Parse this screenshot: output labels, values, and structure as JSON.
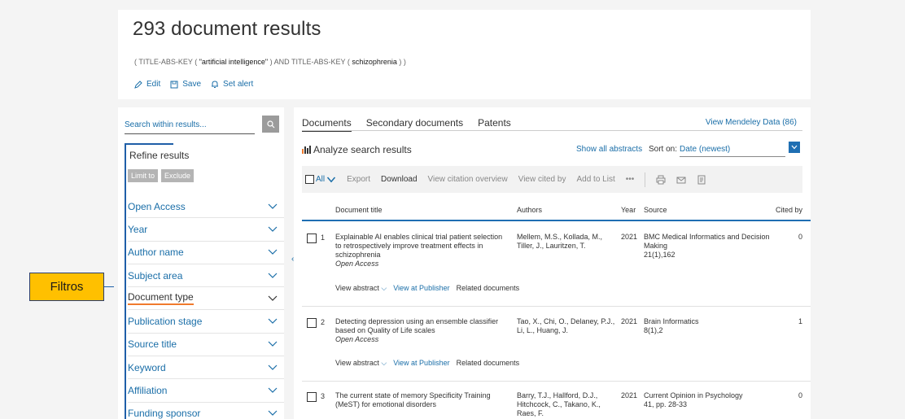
{
  "header": {
    "results_title": "293 document results",
    "query": {
      "part1": "( TITLE-ABS-KEY ( ",
      "term1": "\"artificial intelligence\"",
      "part2": " ) AND  TITLE-ABS-KEY ( ",
      "term2": "schizophrenia",
      "part3": " ) )"
    },
    "actions": {
      "edit": "Edit",
      "save": "Save",
      "alert": "Set alert"
    }
  },
  "sidebar": {
    "search_placeholder": "Search within results...",
    "refine_title": "Refine results",
    "limit_to": "Limit to",
    "exclude": "Exclude",
    "filters": [
      {
        "label": "Open Access"
      },
      {
        "label": "Year"
      },
      {
        "label": "Author name"
      },
      {
        "label": "Subject area"
      },
      {
        "label": "Document type"
      },
      {
        "label": "Publication stage"
      },
      {
        "label": "Source title"
      },
      {
        "label": "Keyword"
      },
      {
        "label": "Affiliation"
      },
      {
        "label": "Funding sponsor"
      }
    ]
  },
  "annotation": {
    "label": "Filtros",
    "color": "#ffc000"
  },
  "main": {
    "tabs": [
      "Documents",
      "Secondary documents",
      "Patents"
    ],
    "mendeley": "View Mendeley Data (86)",
    "analyze": "Analyze search results",
    "show_abstracts": "Show all abstracts",
    "sort_on": "Sort on:",
    "sort_value": "Date (newest)",
    "toolbar": {
      "all": "All",
      "export": "Export",
      "download": "Download",
      "citation_overview": "View citation overview",
      "cited_by": "View cited by",
      "add_to_list": "Add to List",
      "more": "•••"
    },
    "columns": {
      "title": "Document title",
      "authors": "Authors",
      "year": "Year",
      "source": "Source",
      "cited": "Cited by"
    },
    "rows": [
      {
        "num": "1",
        "title": "Explainable AI enables clinical trial patient selection to retrospectively improve treatment effects in schizophrenia",
        "open_access": "Open Access",
        "authors": "Mellem, M.S., Kollada, M., Tiller, J., Lauritzen, T.",
        "year": "2021",
        "source": "BMC Medical Informatics and Decision Making",
        "source_detail": "21(1),162",
        "cited": "0",
        "view_abstract": "View abstract",
        "view_publisher": "View at Publisher",
        "related": "Related documents"
      },
      {
        "num": "2",
        "title": "Detecting depression using an ensemble classifier based on Quality of Life scales",
        "open_access": "Open Access",
        "authors": "Tao, X., Chi, O., Delaney, P.J., Li, L., Huang, J.",
        "year": "2021",
        "source": "Brain Informatics",
        "source_detail": "8(1),2",
        "cited": "1",
        "view_abstract": "View abstract",
        "view_publisher": "View at Publisher",
        "related": "Related documents"
      },
      {
        "num": "3",
        "title": "The current state of memory Specificity Training (MeST) for emotional disorders",
        "authors": "Barry, T.J., Hallford, D.J., Hitchcock, C., Takano, K., Raes, F.",
        "year": "2021",
        "source": "Current Opinion in Psychology",
        "source_detail": "41, pp. 28-33",
        "cited": "0"
      }
    ]
  }
}
